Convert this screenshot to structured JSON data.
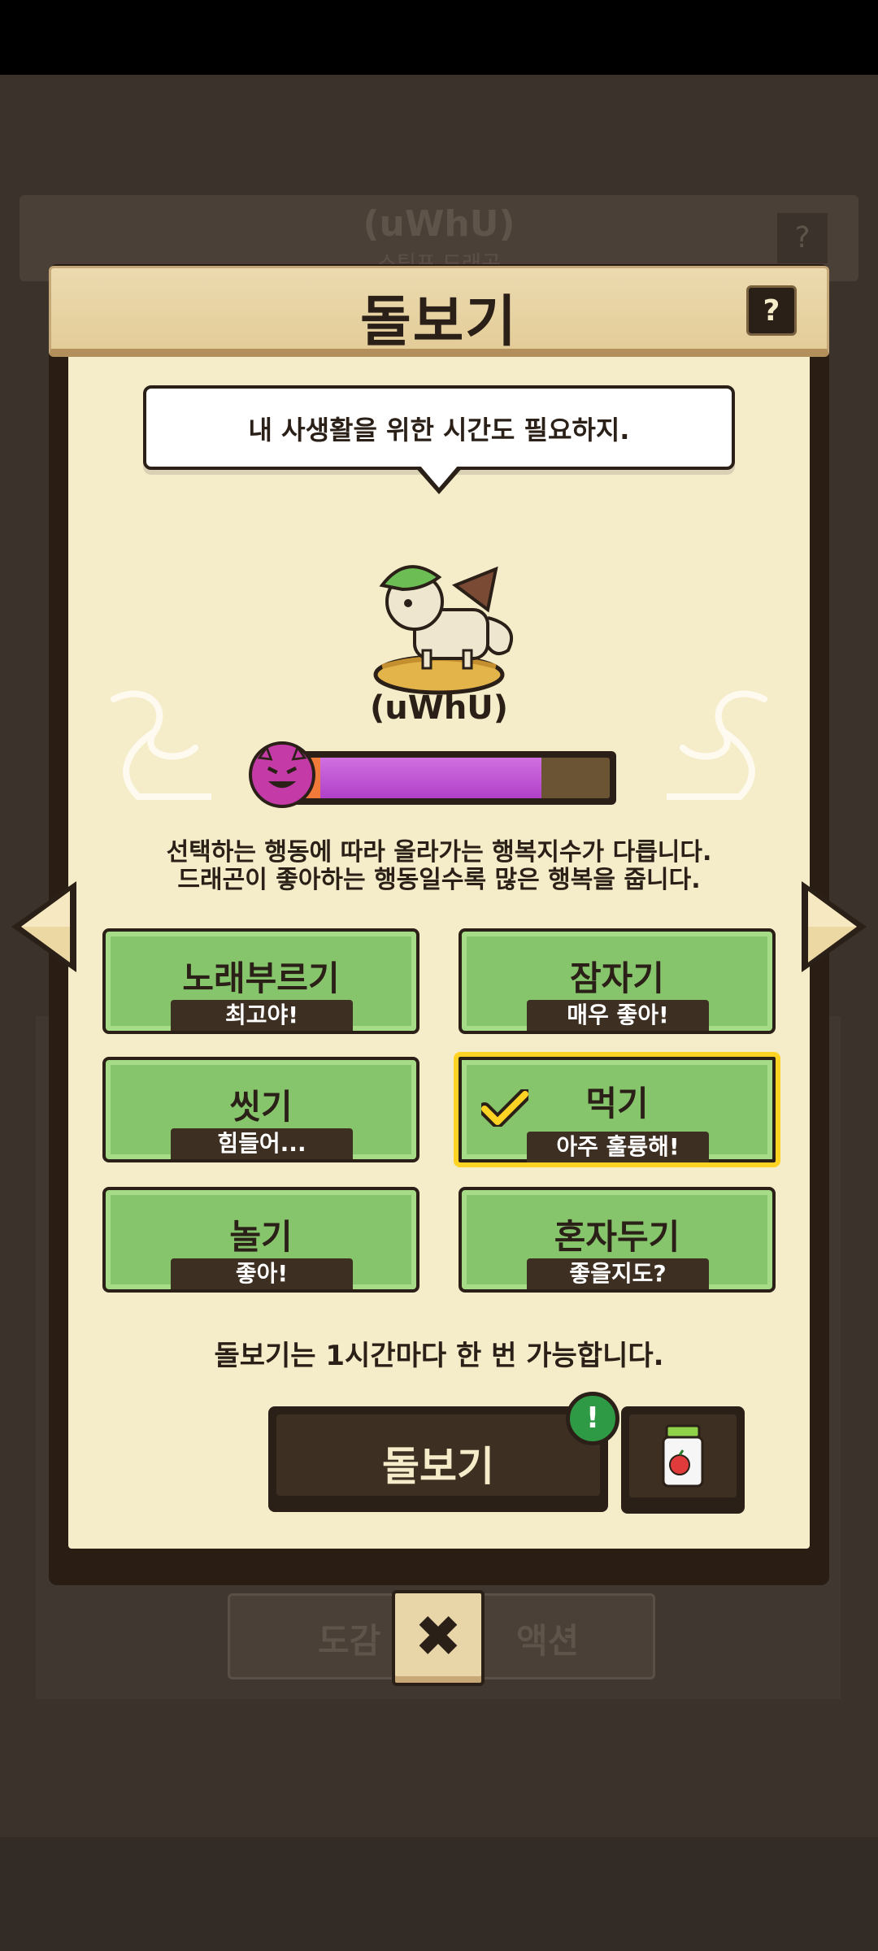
{
  "background": {
    "header_title": "(uWhU)",
    "header_subtitle": "스팀포 드래곤",
    "help_glyph": "?",
    "tab_left": "도감",
    "tab_right": "액션"
  },
  "modal": {
    "title": "돌보기",
    "help_glyph": "?"
  },
  "speech": {
    "text": "내 사생활을 위한 시간도 필요하지."
  },
  "pet": {
    "name": "(uWhU)",
    "happiness_fraction": 0.78,
    "mood_icon": "devil-face-icon"
  },
  "description": {
    "line1": "선택하는 행동에 따라 올라가는 행복지수가 다릅니다.",
    "line2": "드래곤이 좋아하는 행동일수록 많은 행복을 줍니다."
  },
  "actions": [
    {
      "label": "노래부르기",
      "rating": "최고야!"
    },
    {
      "label": "잠자기",
      "rating": "매우 좋아!"
    },
    {
      "label": "씻기",
      "rating": "힘들어..."
    },
    {
      "label": "먹기",
      "rating": "아주 훌륭해!"
    },
    {
      "label": "놀기",
      "rating": "좋아!"
    },
    {
      "label": "혼자두기",
      "rating": "좋을지도?"
    }
  ],
  "selected_action": "먹기",
  "note": "돌보기는 1시간마다 한 번 가능합니다.",
  "care_button": {
    "label": "돌보기",
    "alert": "!"
  },
  "close_glyph": "✖",
  "colors": {
    "panel": "#f5edc9",
    "action_green": "#87c56c",
    "selected_border": "#ffd323",
    "happiness_bar": "#c04ad4",
    "dark_frame": "#2b2018"
  }
}
